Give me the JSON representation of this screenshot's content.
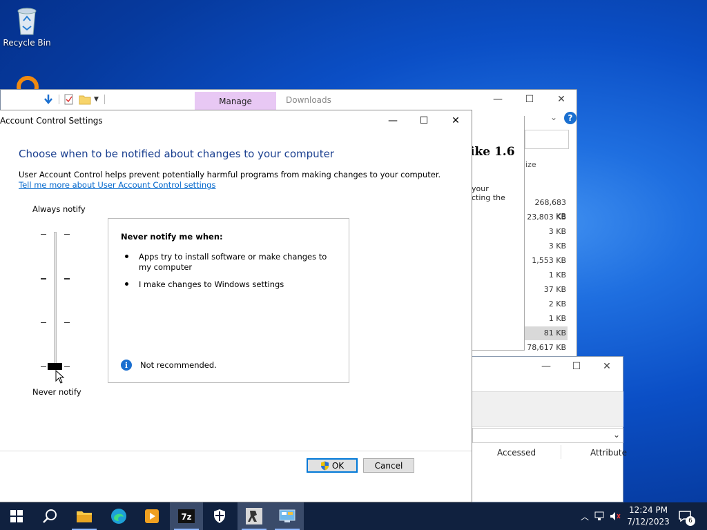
{
  "desktop": {
    "icons": [
      {
        "label": "Recycle Bin",
        "icon": "recycle-bin-icon"
      },
      {
        "label": "",
        "icon": "magnifier-shortcut-icon"
      }
    ]
  },
  "explorer": {
    "manage_tab": "Manage",
    "downloads_label": "Downloads",
    "heading_fragment": "ike 1.6",
    "text_fragments": [
      "your",
      "cting the"
    ],
    "size_header": "ize",
    "sizes": [
      "268,683 KB",
      "23,803 KB",
      "3 KB",
      "3 KB",
      "1,553 KB",
      "1 KB",
      "37 KB",
      "2 KB",
      "1 KB",
      "81 KB",
      "78,617 KB"
    ],
    "selected_index": 9
  },
  "properties": {
    "columns": [
      "Accessed",
      "Attribute"
    ]
  },
  "uac": {
    "title": "Account Control Settings",
    "heading": "Choose when to be notified about changes to your computer",
    "description": "User Account Control helps prevent potentially harmful programs from making changes to your computer.",
    "link": "Tell me more about User Account Control settings",
    "slider_top": "Always notify",
    "slider_bottom": "Never notify",
    "slider_level": 0,
    "slider_levels": 4,
    "info_heading": "Never notify me when:",
    "bullets": [
      "Apps try to install software or make changes to my computer",
      "I make changes to Windows settings"
    ],
    "note": "Not recommended.",
    "ok_label": "OK",
    "cancel_label": "Cancel"
  },
  "taskbar": {
    "items": [
      "start-icon",
      "search-icon",
      "file-explorer-icon",
      "edge-icon",
      "media-player-icon",
      "7zip-icon",
      "security-icon",
      "counter-strike-icon",
      "control-panel-icon"
    ],
    "time": "12:24 PM",
    "date": "7/12/2023",
    "notification_count": "6"
  },
  "colors": {
    "accent": "#0078d7",
    "heading": "#1a3f8f",
    "link": "#0066cc",
    "manage_tab": "#e8c8f4",
    "taskbar": "#10213f"
  }
}
